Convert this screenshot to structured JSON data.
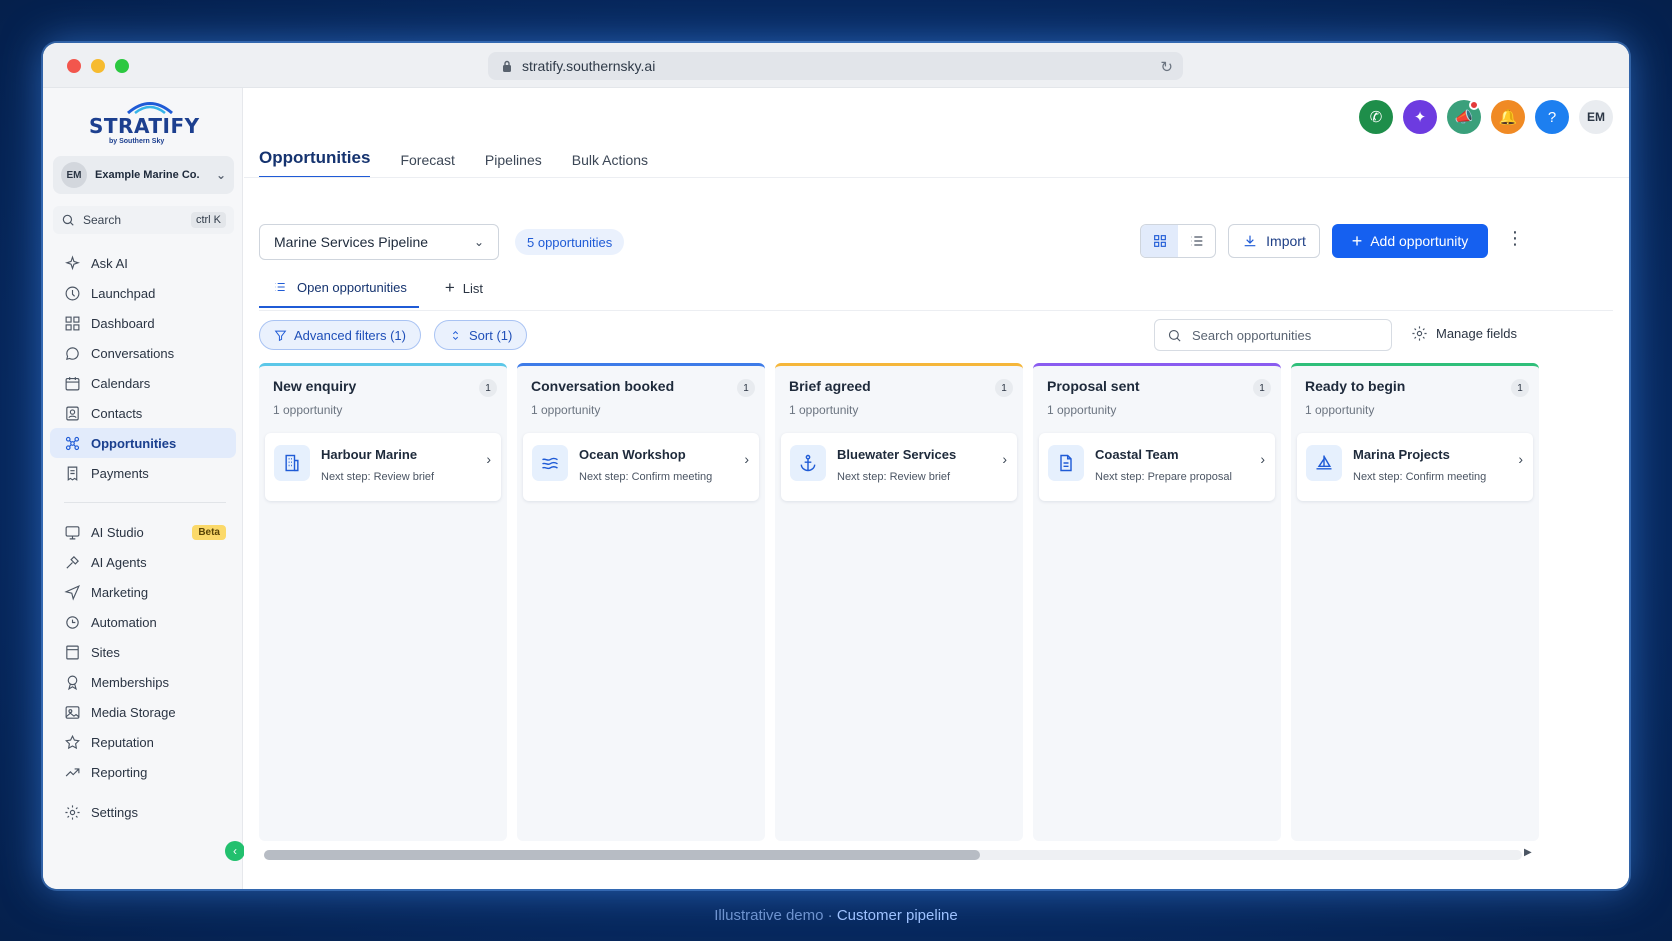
{
  "browser": {
    "url": "stratify.southernsky.ai"
  },
  "brand": {
    "logo_text": "STRATIFY",
    "logo_sub": "by Southern Sky",
    "accent": "#1f5bd6"
  },
  "sidebar": {
    "account": {
      "initials": "EM",
      "name": "Example Marine Co."
    },
    "search": {
      "label": "Search",
      "shortcut": "ctrl K"
    },
    "items": [
      {
        "label": "Ask AI",
        "icon": "sparkle-icon"
      },
      {
        "label": "Launchpad",
        "icon": "rocket-icon"
      },
      {
        "label": "Dashboard",
        "icon": "grid-icon"
      },
      {
        "label": "Conversations",
        "icon": "chat-icon"
      },
      {
        "label": "Calendars",
        "icon": "calendar-icon"
      },
      {
        "label": "Contacts",
        "icon": "contacts-icon"
      },
      {
        "label": "Opportunities",
        "icon": "opportunities-icon",
        "active": true
      },
      {
        "label": "Payments",
        "icon": "receipt-icon"
      }
    ],
    "items2": [
      {
        "label": "AI Studio",
        "icon": "ai-studio-icon",
        "badge": "Beta"
      },
      {
        "label": "AI Agents",
        "icon": "agents-icon"
      },
      {
        "label": "Marketing",
        "icon": "send-icon"
      },
      {
        "label": "Automation",
        "icon": "automation-icon"
      },
      {
        "label": "Sites",
        "icon": "sites-icon"
      },
      {
        "label": "Memberships",
        "icon": "award-icon"
      },
      {
        "label": "Media Storage",
        "icon": "image-icon"
      },
      {
        "label": "Reputation",
        "icon": "star-icon"
      },
      {
        "label": "Reporting",
        "icon": "trend-icon"
      }
    ],
    "settings": "Settings"
  },
  "header": {
    "user_initials": "EM",
    "tabs": [
      "Opportunities",
      "Forecast",
      "Pipelines",
      "Bulk Actions"
    ]
  },
  "toolbar": {
    "pipeline": "Marine Services Pipeline",
    "count": "5 opportunities",
    "import": "Import",
    "add": "Add opportunity"
  },
  "subtabs": {
    "open": "Open opportunities",
    "list": "List"
  },
  "filters": {
    "advanced": "Advanced filters (1)",
    "sort": "Sort (1)",
    "search_placeholder": "Search opportunities",
    "manage": "Manage fields"
  },
  "columns": [
    {
      "title": "New enquiry",
      "count": "1",
      "sub": "1 opportunity",
      "color": "#5bc7e8",
      "card": {
        "name": "Harbour Marine",
        "step": "Next step: Review brief",
        "icon": "building-icon"
      }
    },
    {
      "title": "Conversation booked",
      "count": "1",
      "sub": "1 opportunity",
      "color": "#3d7be8",
      "card": {
        "name": "Ocean Workshop",
        "step": "Next step: Confirm meeting",
        "icon": "waves-icon"
      }
    },
    {
      "title": "Brief agreed",
      "count": "1",
      "sub": "1 opportunity",
      "color": "#f5b63a",
      "card": {
        "name": "Bluewater Services",
        "step": "Next step: Review brief",
        "icon": "anchor-icon"
      }
    },
    {
      "title": "Proposal sent",
      "count": "1",
      "sub": "1 opportunity",
      "color": "#8a5cf0",
      "card": {
        "name": "Coastal Team",
        "step": "Next step: Prepare proposal",
        "icon": "document-icon"
      }
    },
    {
      "title": "Ready to begin",
      "count": "1",
      "sub": "1 opportunity",
      "color": "#2fbf7a",
      "card": {
        "name": "Marina Projects",
        "step": "Next step: Confirm meeting",
        "icon": "sailboat-icon"
      }
    }
  ],
  "caption": {
    "prefix": "Illustrative demo · ",
    "highlight": "Customer pipeline"
  }
}
